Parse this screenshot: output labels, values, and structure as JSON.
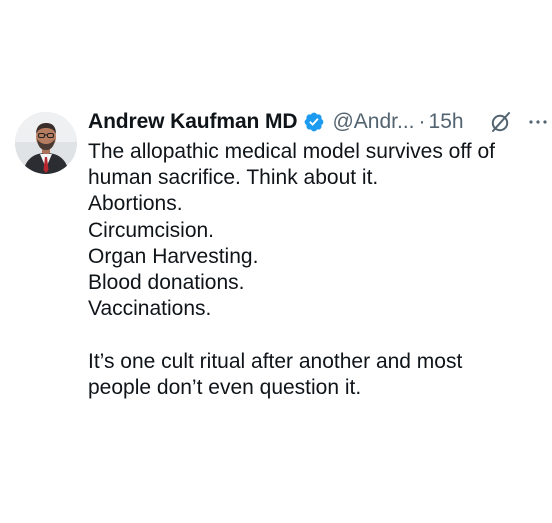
{
  "tweet": {
    "author": {
      "display_name": "Andrew Kaufman MD",
      "handle": "@Andr...",
      "verified": true,
      "avatar": "profile-photo"
    },
    "separator": "·",
    "time": "15h",
    "icons": {
      "verified": "verified-badge-icon",
      "grok": "grok-icon",
      "more": "more-options-icon"
    },
    "colors": {
      "verified_blue": "#1d9bf0",
      "secondary_text": "#536471",
      "primary_text": "#0f1419"
    },
    "lines": [
      "The allopathic medical model survives off of",
      "human sacrifice. Think about it.",
      "Abortions.",
      "Circumcision.",
      "Organ Harvesting.",
      "Blood donations.",
      "Vaccinations."
    ],
    "closing_lines": [
      "It’s one cult ritual after another and most",
      "people don’t even question it."
    ]
  }
}
